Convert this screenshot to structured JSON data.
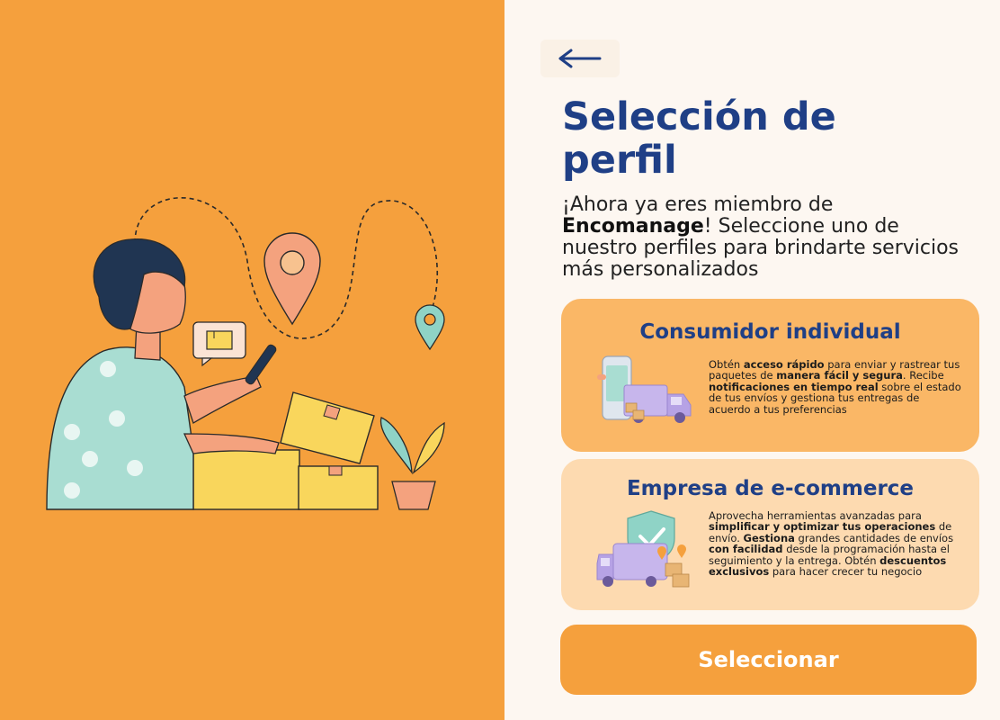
{
  "header": {
    "back_label": "←",
    "title": "Selección de perfil"
  },
  "intro": {
    "part1": "¡Ahora ya eres miembro de ",
    "brand": "Encomanage",
    "part2": "! Seleccione uno de nuestro perfiles para brindarte servicios más personalizados"
  },
  "profiles": [
    {
      "title": "Consumidor individual",
      "segments": [
        "Obtén ",
        "acceso rápido",
        " para enviar y rastrear tus paquetes de ",
        "manera fácil y segura",
        ". Recibe ",
        "notificaciones en tiempo real",
        " sobre el estado de tus envíos y gestiona tus entregas de acuerdo a tus preferencias"
      ],
      "icon": "phone-delivery-truck-icon"
    },
    {
      "title": "Empresa de e-commerce",
      "segments": [
        "Aprovecha herramientas avanzadas para ",
        "simplificar y optimizar tus operaciones",
        " de envío. ",
        "Gestiona",
        " grandes cantidades de envíos ",
        "con facilidad",
        " desde la programación hasta el seguimiento y la entrega. Obtén ",
        "descuentos exclusivos",
        " para hacer crecer tu negocio"
      ],
      "icon": "shield-truck-icon"
    }
  ],
  "actions": {
    "select_label": "Seleccionar"
  },
  "illustration": {
    "icon": "woman-packages-location-illustration"
  },
  "colors": {
    "orange": "#f5a03d",
    "card1": "#fab766",
    "card2": "#fddab0",
    "navy": "#1f3f86",
    "cream": "#fdf7f1"
  }
}
